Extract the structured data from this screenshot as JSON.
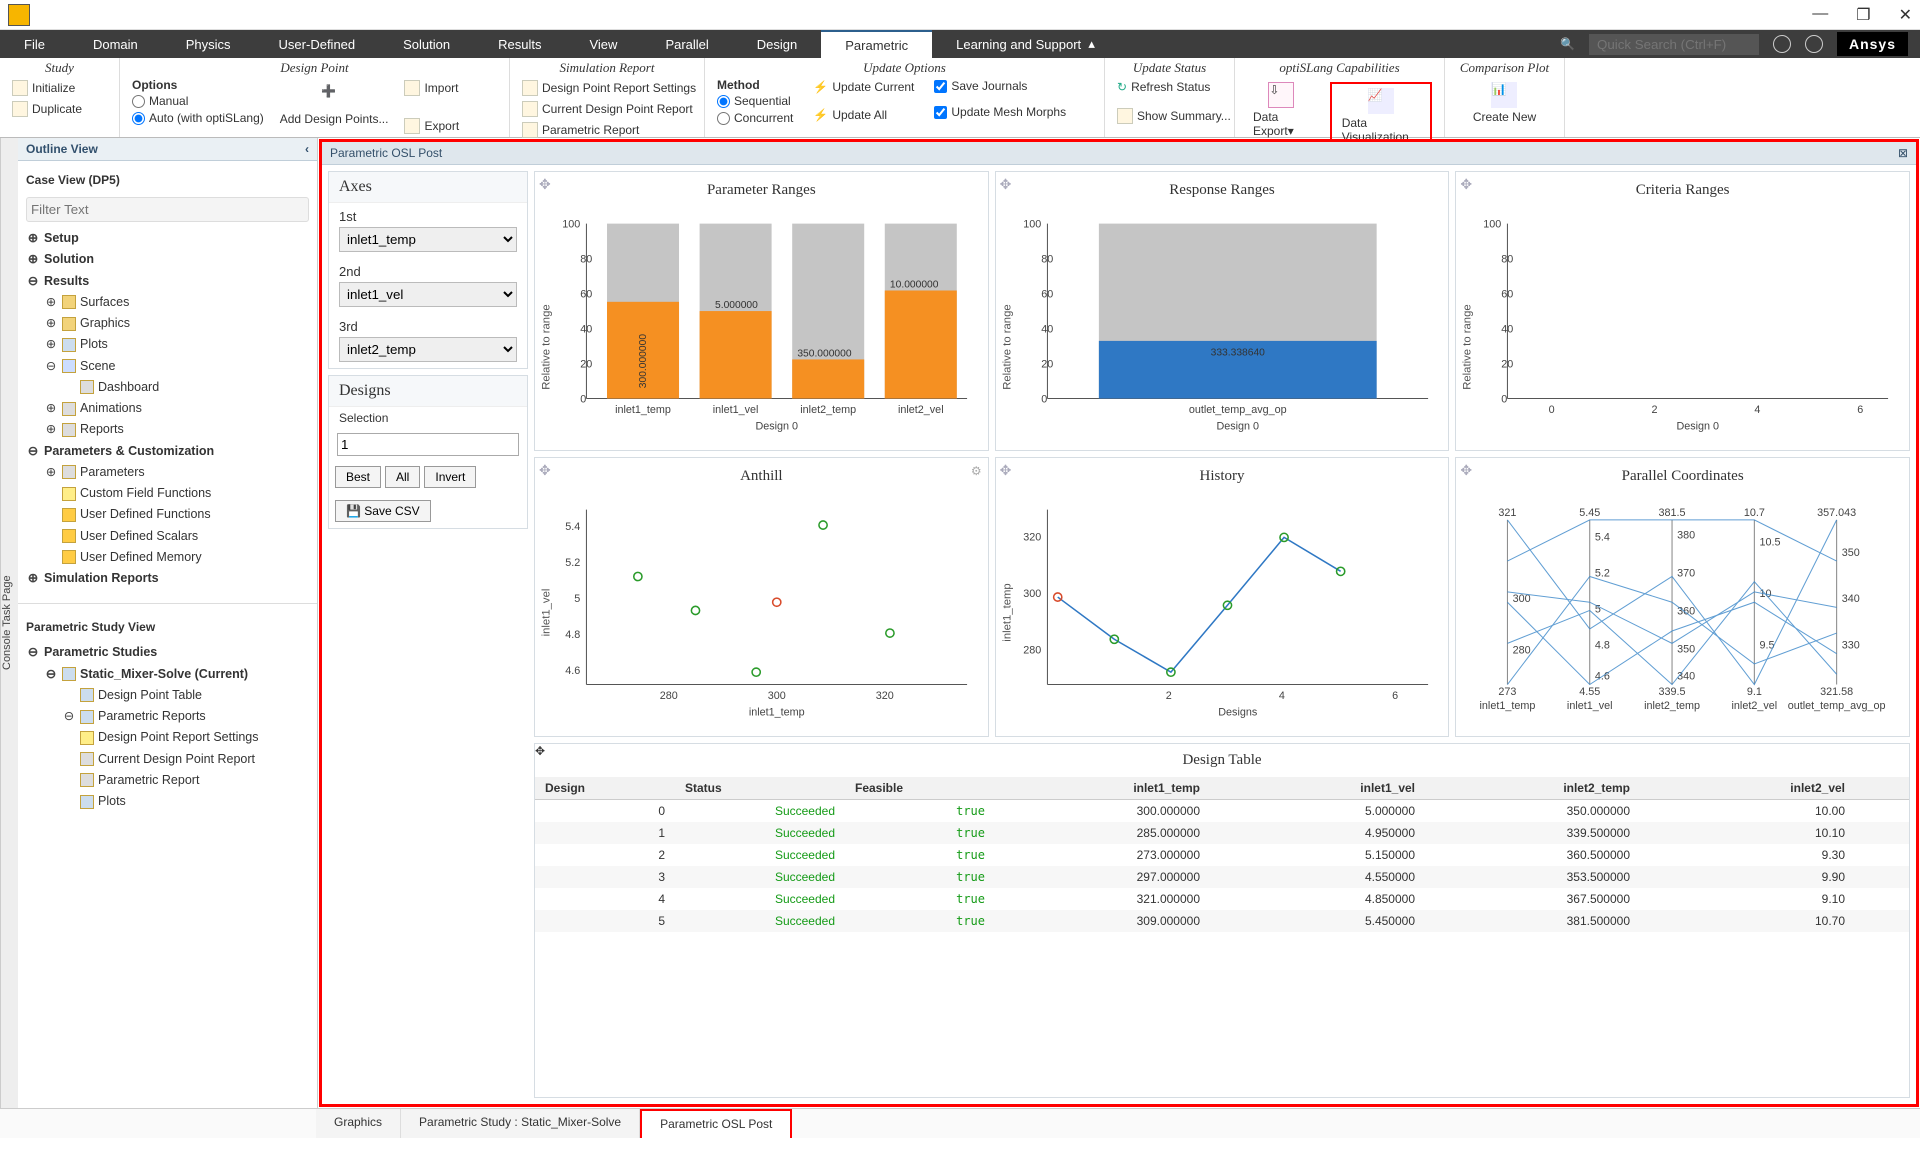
{
  "titlebar": {
    "min": "—",
    "max": "❐",
    "close": "✕"
  },
  "menus": [
    "File",
    "Domain",
    "Physics",
    "User-Defined",
    "Solution",
    "Results",
    "View",
    "Parallel",
    "Design",
    "Parametric",
    "Learning and Support"
  ],
  "active_menu": "Parametric",
  "search_placeholder": "Quick Search (Ctrl+F)",
  "brand": "Ansys",
  "ribbon": {
    "study": {
      "title": "Study",
      "initialize": "Initialize",
      "duplicate": "Duplicate"
    },
    "design_point": {
      "title": "Design Point",
      "options": "Options",
      "manual": "Manual",
      "auto": "Auto (with optiSLang)",
      "add_dp": "Add Design Points...",
      "import": "Import",
      "export": "Export"
    },
    "sim_report": {
      "title": "Simulation Report",
      "dprs": "Design Point Report Settings",
      "cdpr": "Current Design Point Report",
      "pr": "Parametric Report"
    },
    "update": {
      "title": "Update Options",
      "method": "Method",
      "seq": "Sequential",
      "conc": "Concurrent",
      "upd_cur": "Update Current",
      "upd_all": "Update All",
      "save_j": "Save Journals",
      "upd_mesh": "Update Mesh Morphs"
    },
    "status": {
      "title": "Update Status",
      "refresh": "Refresh Status",
      "summary": "Show Summary..."
    },
    "osl": {
      "title": "optiSLang Capabilities",
      "export": "Data Export",
      "dataviz": "Data Visualization"
    },
    "comp": {
      "title": "Comparison Plot",
      "new": "Create New"
    }
  },
  "outline_title": "Outline View",
  "case_view": {
    "title": "Case View (DP5)",
    "filter_ph": "Filter Text"
  },
  "tree": {
    "setup": "Setup",
    "solution": "Solution",
    "results": "Results",
    "surfaces": "Surfaces",
    "graphics": "Graphics",
    "plots": "Plots",
    "scene": "Scene",
    "dashboard": "Dashboard",
    "animations": "Animations",
    "reports": "Reports",
    "pc": "Parameters & Customization",
    "params": "Parameters",
    "cff": "Custom Field Functions",
    "udf": "User Defined Functions",
    "uds": "User Defined Scalars",
    "udm": "User Defined Memory",
    "simrep": "Simulation Reports"
  },
  "psv": {
    "title": "Parametric Study View",
    "ps": "Parametric Studies",
    "sms": "Static_Mixer-Solve (Current)",
    "dpt": "Design Point Table",
    "prs": "Parametric Reports",
    "dprs": "Design Point Report Settings",
    "cdpr": "Current Design Point Report",
    "pr": "Parametric Report",
    "plots": "Plots"
  },
  "center_title": "Parametric OSL Post",
  "axes_panel": {
    "title": "Axes",
    "first": "1st",
    "second": "2nd",
    "third": "3rd",
    "sel1": "inlet1_temp",
    "sel2": "inlet1_vel",
    "sel3": "inlet2_temp"
  },
  "designs_panel": {
    "title": "Designs",
    "selection": "Selection",
    "sel_val": "1",
    "best": "Best",
    "all": "All",
    "invert": "Invert",
    "save": "Save CSV"
  },
  "plots": {
    "param_ranges": "Parameter Ranges",
    "resp_ranges": "Response Ranges",
    "crit_ranges": "Criteria Ranges",
    "anthill": "Anthill",
    "history": "History",
    "parco": "Parallel Coordinates",
    "design_table": "Design Table",
    "design0": "Design 0",
    "designs": "Designs",
    "rel": "Relative to range"
  },
  "chart_data": {
    "parameter_ranges": {
      "type": "bar",
      "ylim": [
        0,
        100
      ],
      "ylabel": "Relative to range",
      "categories": [
        "inlet1_temp",
        "inlet1_vel",
        "inlet2_temp",
        "inlet2_vel"
      ],
      "values": [
        55,
        50,
        22,
        62
      ],
      "labels": [
        "300.000000",
        "5.000000",
        "350.000000",
        "10.000000"
      ]
    },
    "response_ranges": {
      "type": "bar",
      "ylim": [
        0,
        100
      ],
      "ylabel": "Relative to range",
      "categories": [
        "outlet_temp_avg_op"
      ],
      "values": [
        33
      ],
      "labels": [
        "333.338640"
      ]
    },
    "criteria_ranges": {
      "type": "bar",
      "ylim": [
        0,
        100
      ],
      "ylabel": "Relative to range",
      "x_ticks": [
        0,
        2,
        4,
        6
      ],
      "values": []
    },
    "anthill": {
      "type": "scatter",
      "xlabel": "inlet1_temp",
      "ylabel": "inlet1_vel",
      "points": [
        [
          285,
          4.95
        ],
        [
          297,
          4.55
        ],
        [
          321,
          4.85
        ],
        [
          309,
          5.45
        ],
        [
          273,
          5.15
        ],
        [
          300,
          5.0
        ]
      ],
      "highlight_index": 5,
      "xlim": [
        270,
        330
      ],
      "ylim": [
        4.4,
        5.6
      ]
    },
    "history": {
      "type": "line",
      "xlabel": "Designs",
      "ylabel": "inlet1_temp",
      "x": [
        0,
        1,
        2,
        3,
        4,
        5
      ],
      "y": [
        300,
        285,
        273,
        297,
        321,
        309
      ],
      "ylim": [
        270,
        330
      ]
    },
    "parallel_coordinates": {
      "type": "parallel",
      "axes": [
        "inlet1_temp",
        "inlet1_vel",
        "inlet2_temp",
        "inlet2_vel",
        "outlet_temp_avg_op"
      ],
      "bounds": [
        [
          273,
          321
        ],
        [
          4.55,
          5.45
        ],
        [
          339.5,
          381.5
        ],
        [
          9.1,
          10.7
        ],
        [
          321.58,
          357.043
        ]
      ],
      "ticks": [
        [
          "321",
          "300",
          "280",
          "273"
        ],
        [
          "5.45",
          "5.4",
          "5.2",
          "5",
          "4.8",
          "4.6",
          "4.55"
        ],
        [
          "381.5",
          "380",
          "370",
          "360",
          "350",
          "340",
          "339.5"
        ],
        [
          "10.7",
          "10.5",
          "10",
          "9.5",
          "9.1"
        ],
        [
          "357.043",
          "350",
          "340",
          "330",
          "321.58"
        ]
      ]
    }
  },
  "table": {
    "cols": [
      "Design",
      "Status",
      "Feasible",
      "inlet1_temp",
      "inlet1_vel",
      "inlet2_temp",
      "inlet2_vel"
    ],
    "rows": [
      [
        "0",
        "Succeeded",
        "true",
        "300.000000",
        "5.000000",
        "350.000000",
        "10.00"
      ],
      [
        "1",
        "Succeeded",
        "true",
        "285.000000",
        "4.950000",
        "339.500000",
        "10.10"
      ],
      [
        "2",
        "Succeeded",
        "true",
        "273.000000",
        "5.150000",
        "360.500000",
        "9.30"
      ],
      [
        "3",
        "Succeeded",
        "true",
        "297.000000",
        "4.550000",
        "353.500000",
        "9.90"
      ],
      [
        "4",
        "Succeeded",
        "true",
        "321.000000",
        "4.850000",
        "367.500000",
        "9.10"
      ],
      [
        "5",
        "Succeeded",
        "true",
        "309.000000",
        "5.450000",
        "381.500000",
        "10.70"
      ]
    ]
  },
  "bottom_tabs": [
    "Graphics",
    "Parametric Study : Static_Mixer-Solve",
    "Parametric OSL Post"
  ]
}
